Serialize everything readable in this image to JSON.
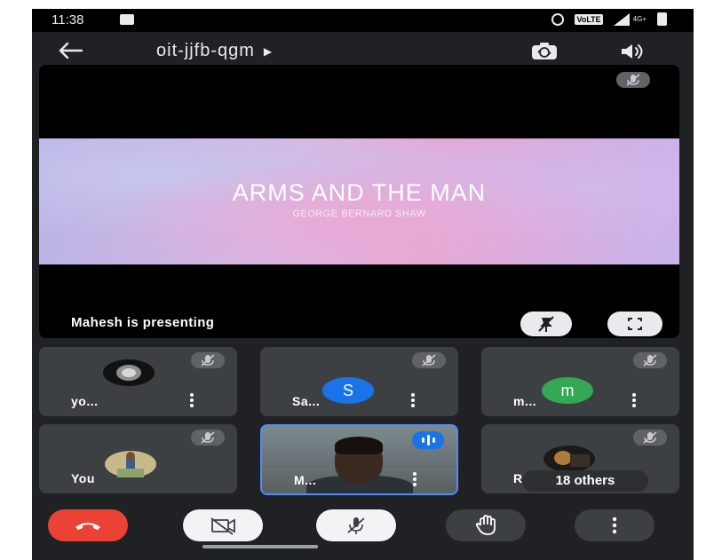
{
  "status_bar": {
    "time": "11:38",
    "volte": "VoLTE",
    "network": "4G+"
  },
  "meeting": {
    "code": "oit-jjfb-qgm"
  },
  "presentation": {
    "slide_title": "ARMS AND THE MAN",
    "slide_subtitle": "GEORGE BERNARD SHAW",
    "presenter_text": "Mahesh is presenting"
  },
  "tiles": [
    {
      "name": "yo...",
      "muted": true
    },
    {
      "name": "Sa...",
      "initial": "S",
      "avatar_color": "#1a73e8",
      "muted": true
    },
    {
      "name": "m...",
      "initial": "m",
      "avatar_color": "#34a853",
      "muted": true
    },
    {
      "name": "You",
      "muted": true
    },
    {
      "name": "M...",
      "speaking": true
    },
    {
      "name": "RA...",
      "muted": true
    }
  ],
  "others": {
    "label": "18 others"
  },
  "controls": {
    "end_call": "end-call",
    "camera": "camera-off",
    "mic": "mic-off",
    "hand": "raise-hand",
    "more": "more-options"
  },
  "colors": {
    "background": "#202124",
    "tile": "#3c4043",
    "end_call": "#ea4335",
    "accent": "#1a73e8"
  }
}
